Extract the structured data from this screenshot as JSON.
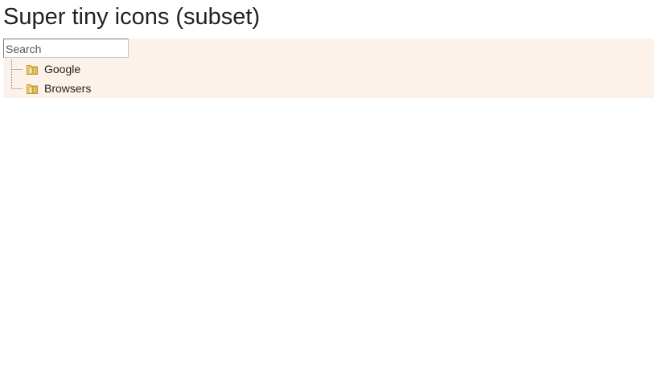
{
  "page": {
    "title": "Super tiny icons (subset)"
  },
  "search": {
    "placeholder": "Search",
    "value": ""
  },
  "tree": {
    "nodes": [
      {
        "label": "Google",
        "icon": "folder-icon"
      },
      {
        "label": "Browsers",
        "icon": "folder-icon"
      }
    ]
  },
  "colors": {
    "panel_background": "#fcf2ea",
    "folder_fill": "#f3d97a",
    "folder_stroke": "#b79a3c",
    "tree_line": "#777777"
  }
}
